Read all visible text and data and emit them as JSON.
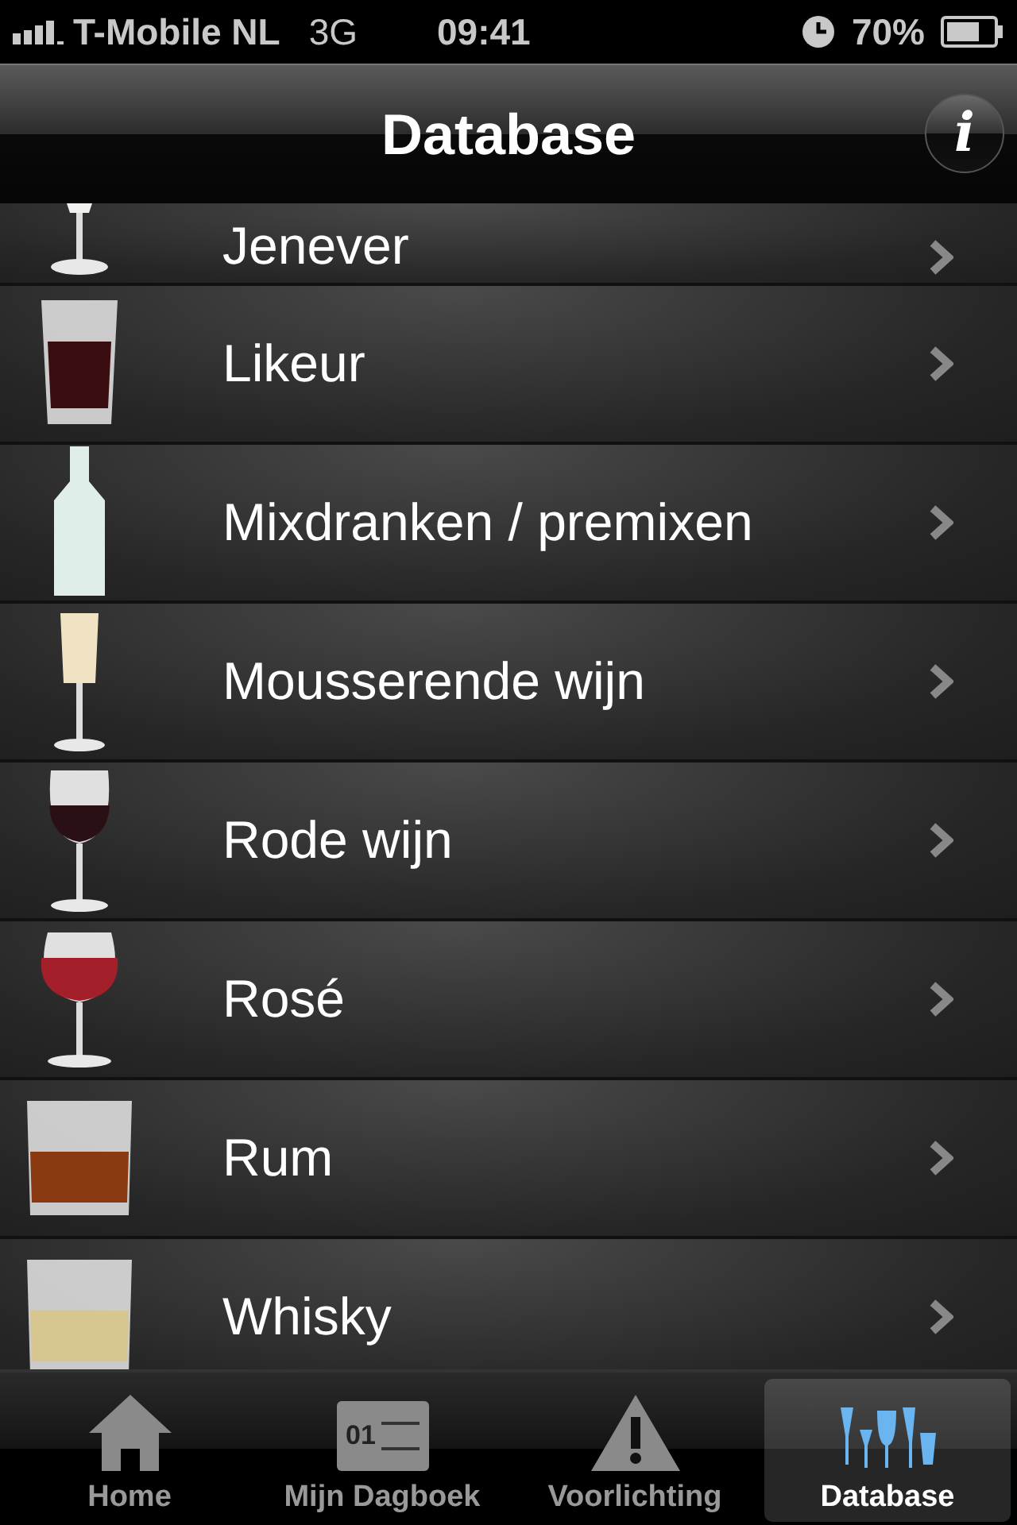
{
  "status_bar": {
    "carrier": "T-Mobile NL",
    "network": "3G",
    "time": "09:41",
    "battery": "70%"
  },
  "nav_bar": {
    "title": "Database",
    "info_button": "i"
  },
  "list": [
    {
      "label": "Jenever",
      "kind": "tulip",
      "color": "#f0f0ee"
    },
    {
      "label": "Likeur",
      "kind": "tumbler",
      "color": "#3a0d10"
    },
    {
      "label": "Mixdranken / premixen",
      "kind": "bottle",
      "color": "#dfeee8"
    },
    {
      "label": "Mousserende wijn",
      "kind": "flute",
      "color": "#efe3c4"
    },
    {
      "label": "Rode wijn",
      "kind": "wine",
      "color": "#2a1014"
    },
    {
      "label": "Rosé",
      "kind": "balloon",
      "color": "#a3202a"
    },
    {
      "label": "Rum",
      "kind": "rocks",
      "color": "#8a3a10"
    },
    {
      "label": "Whisky",
      "kind": "rocks",
      "color": "#d8c690"
    }
  ],
  "tabs": [
    {
      "label": "Home",
      "kind": "home",
      "selected": false
    },
    {
      "label": "Mijn Dagboek",
      "kind": "calendar",
      "selected": false,
      "icon_text": "01"
    },
    {
      "label": "Voorlichting",
      "kind": "warning",
      "selected": false
    },
    {
      "label": "Database",
      "kind": "glasses",
      "selected": true
    }
  ]
}
